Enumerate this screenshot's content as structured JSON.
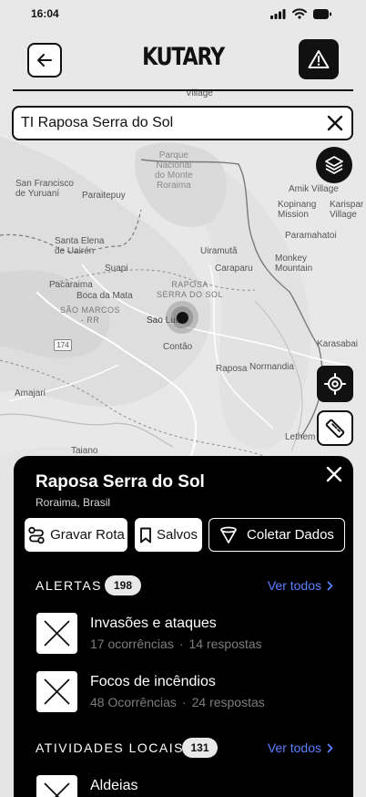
{
  "status_bar": {
    "time": "16:04"
  },
  "header": {
    "title": "KUTARY"
  },
  "search": {
    "value": "TI Raposa Serra do Sol"
  },
  "map": {
    "labels": {
      "village": "Village",
      "parque": "Parque\nNacional\ndo Monte\nRoraima",
      "san_francisco": "San Francisco\nde Yuruaní",
      "paraitepuy": "Paraitepuy",
      "amik": "Amik Village",
      "kopinang": "Kopinang\nMission",
      "karispar": "Karispar\nVillage",
      "paramahatoi": "Paramahatoi",
      "santa_elena": "Santa Elena\nde Uairén",
      "uiramuta": "Uiramutã",
      "suapi": "Suapi",
      "caraparu": "Caraparu",
      "monkey": "Monkey\nMountain",
      "pacaraima": "Pacaraima",
      "raposa_region": "RAPOSA\nSERRA DO SOL",
      "boca": "Boca da Mata",
      "sao_marcos": "SÃO MARCOS\n- RR",
      "sao_luiz": "Sao Luiz",
      "road_174": "174",
      "contao": "Contão",
      "karasabai": "Karasabai",
      "raposa": "Raposa",
      "normandia": "Normandia",
      "amajari": "Amajari",
      "lethem": "Lethem",
      "taiano": "Taiano"
    }
  },
  "sheet": {
    "title": "Raposa Serra do Sol",
    "subtitle": "Roraima, Brasil",
    "actions": {
      "gravar_rota": "Gravar Rota",
      "salvos": "Salvos",
      "coletar": "Coletar Dados"
    },
    "alerts": {
      "title": "ALERTAS",
      "count": "198",
      "see_all": "Ver todos",
      "items": [
        {
          "title": "Invasões e ataques",
          "occurrences": "17 ocorrências",
          "responses": "14 respostas"
        },
        {
          "title": "Focos de incêndios",
          "occurrences": "48 Ocorrências",
          "responses": "24 respostas"
        }
      ]
    },
    "activities": {
      "title": "ATIVIDADES LOCAIS",
      "count": "131",
      "see_all": "Ver todos",
      "items": [
        {
          "title": "Aldeias"
        }
      ]
    }
  },
  "icons": {
    "back": "arrow-left-icon",
    "alert": "warning-triangle-icon",
    "clear": "close-icon",
    "layers": "layers-icon",
    "locate": "crosshair-icon",
    "ruler": "ruler-icon",
    "route": "route-icon",
    "bookmark": "bookmark-icon",
    "funnel": "funnel-icon",
    "chevron": "chevron-right-icon"
  },
  "colors": {
    "accent_link": "#5b80ff",
    "sheet_bg": "#000000",
    "primary": "#111111"
  }
}
